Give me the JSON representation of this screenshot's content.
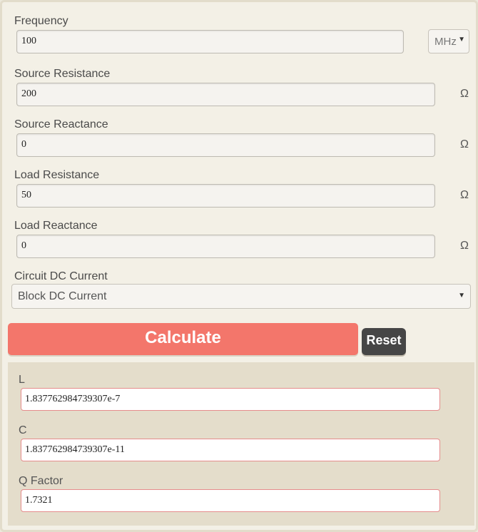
{
  "inputs": {
    "frequency": {
      "label": "Frequency",
      "value": "100",
      "unit": "MHz"
    },
    "source_resistance": {
      "label": "Source Resistance",
      "value": "200",
      "unit": "Ω"
    },
    "source_reactance": {
      "label": "Source Reactance",
      "value": "0",
      "unit": "Ω"
    },
    "load_resistance": {
      "label": "Load Resistance",
      "value": "50",
      "unit": "Ω"
    },
    "load_reactance": {
      "label": "Load Reactance",
      "value": "0",
      "unit": "Ω"
    },
    "circuit_dc_current": {
      "label": "Circuit DC Current",
      "value": "Block DC Current"
    }
  },
  "buttons": {
    "calculate": "Calculate",
    "reset": "Reset"
  },
  "results": {
    "L": {
      "label": "L",
      "value": "1.837762984739307e-7"
    },
    "C": {
      "label": "C",
      "value": "1.837762984739307e-11"
    },
    "Q": {
      "label": "Q Factor",
      "value": "1.7321"
    }
  },
  "colors": {
    "calculate": "#f3766b",
    "reset": "#464646",
    "result_border": "#e58c8c"
  }
}
